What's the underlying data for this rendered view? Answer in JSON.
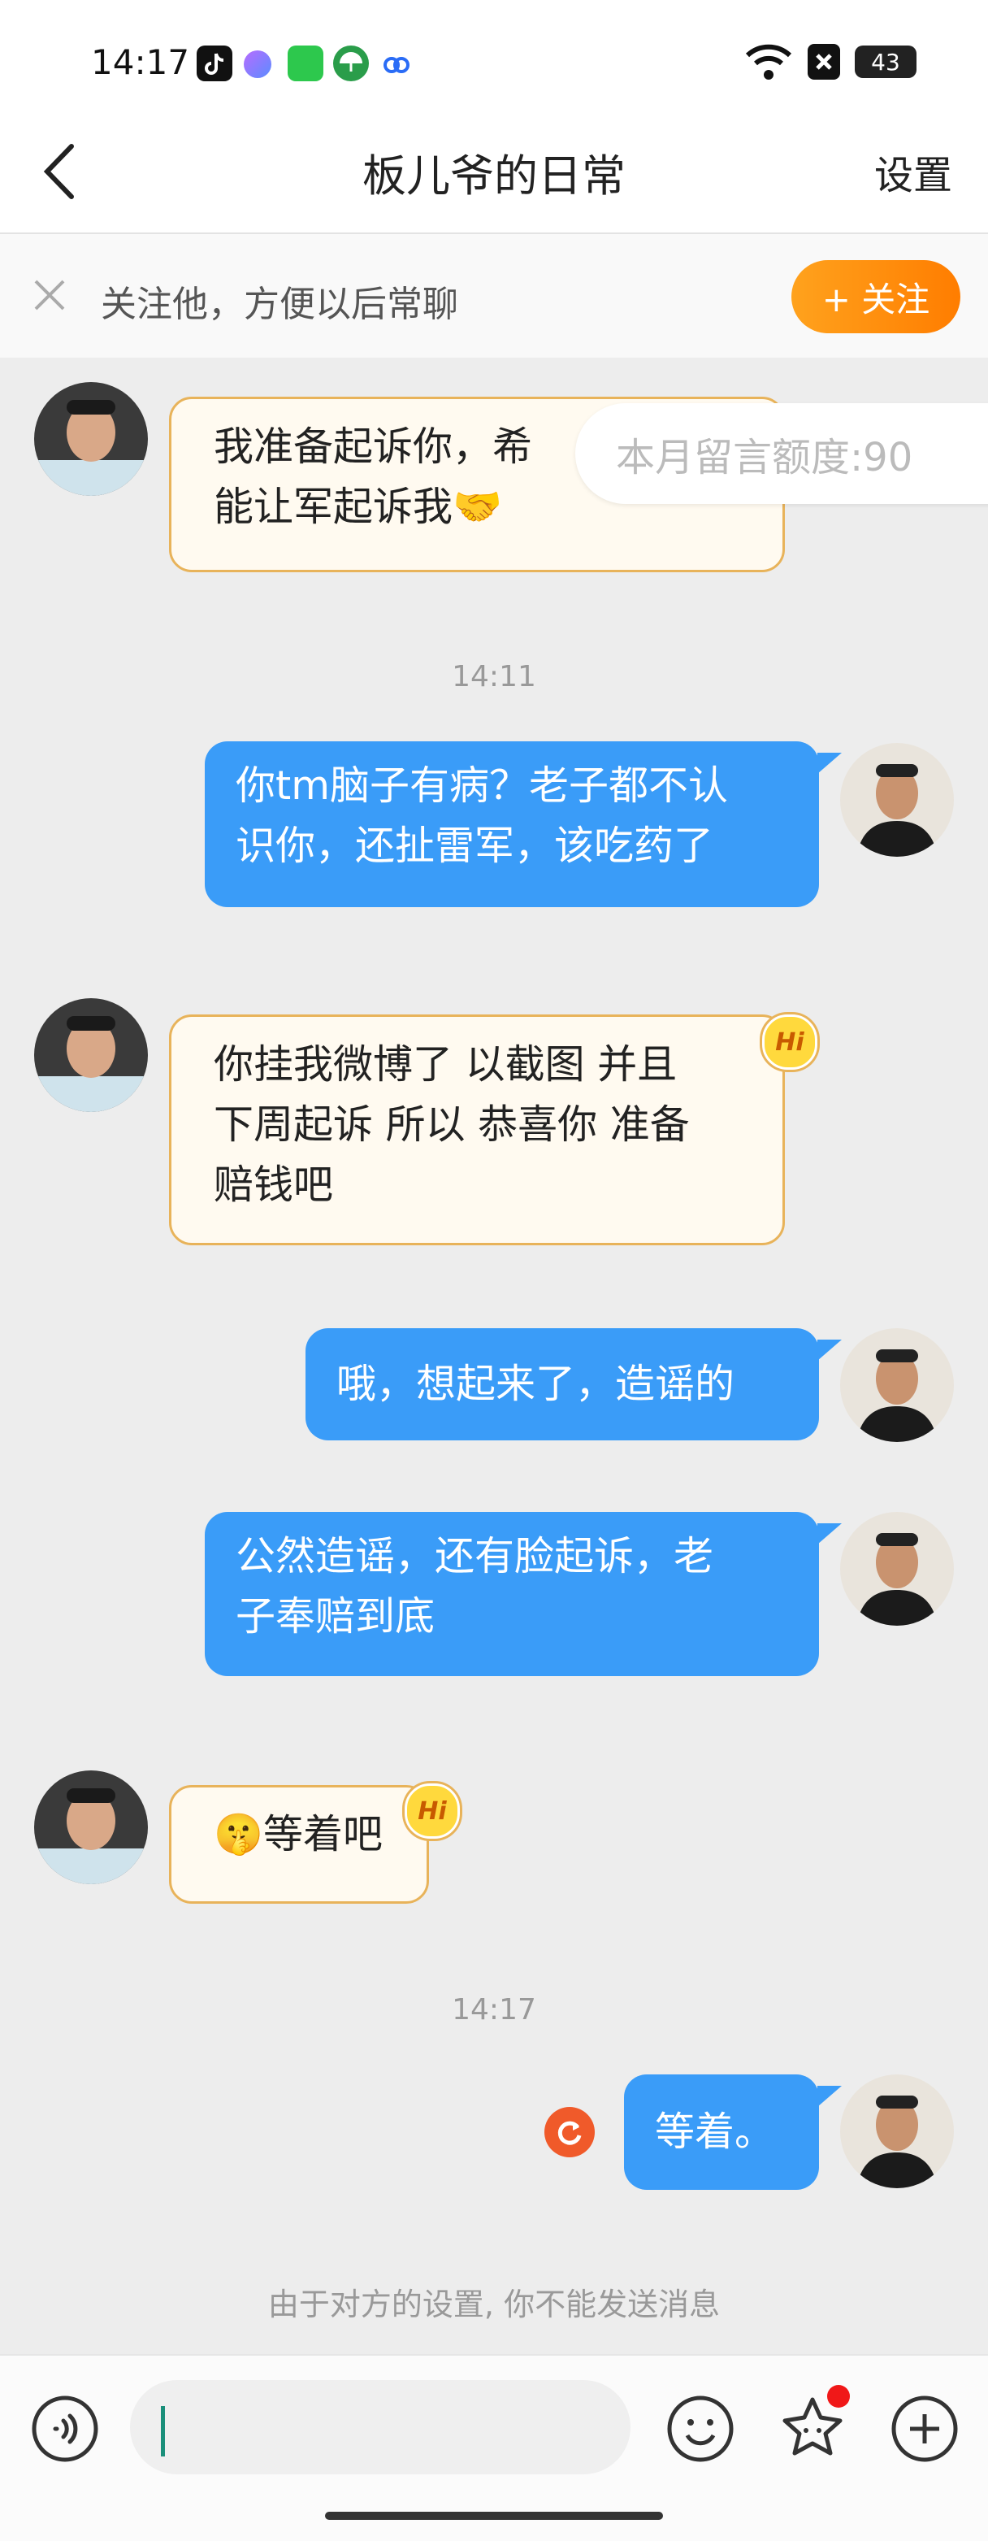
{
  "status_bar": {
    "time": "14:17",
    "battery": "43"
  },
  "header": {
    "title": "板儿爷的日常",
    "settings_label": "设置"
  },
  "follow_bar": {
    "text": "关注他，方便以后常聊",
    "button_label": "+ 关注"
  },
  "quota_tip": "本月留言额度:90",
  "messages": [
    {
      "side": "left",
      "text": "我准备起诉你，希能让军起诉我🤝",
      "line1": "我准备起诉你，希",
      "line2": "能让军起诉我🤝"
    },
    {
      "side": "time",
      "text": "14:11"
    },
    {
      "side": "right",
      "line1": "你tm脑子有病？老子都不认",
      "line2": "识你，还扯雷军，该吃药了"
    },
    {
      "side": "left",
      "line1": "你挂我微博了 以截图 并且",
      "line2": "下周起诉 所以 恭喜你 准备",
      "line3": "赔钱吧",
      "badge": "Hi"
    },
    {
      "side": "right",
      "line1": "哦，想起来了，造谣的"
    },
    {
      "side": "right",
      "line1": "公然造谣，还有脸起诉，老",
      "line2": "子奉赔到底"
    },
    {
      "side": "left",
      "line1": "🤫等着吧",
      "badge": "Hi"
    },
    {
      "side": "time",
      "text": "14:17"
    },
    {
      "side": "right",
      "line1": "等着。"
    }
  ],
  "notice": "由于对方的设置, 你不能发送消息",
  "icons": {
    "back": "chevron-left-icon",
    "close": "close-icon",
    "voice": "voice-icon",
    "emoji": "smile-icon",
    "sticker": "star-face-icon",
    "plus": "plus-circle-icon",
    "retry": "retry-icon"
  },
  "colors": {
    "accent": "#ff8a00",
    "bubble_right": "#3a9cf8",
    "bubble_left_border": "#e8b35a",
    "retry": "#f05a2a"
  }
}
